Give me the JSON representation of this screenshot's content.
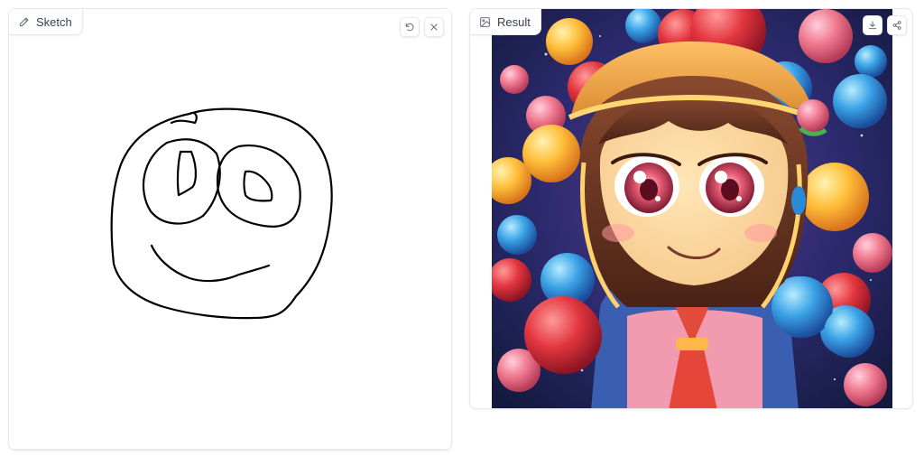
{
  "sketch": {
    "label": "Sketch",
    "label_icon": "pencil-icon",
    "actions": [
      "undo-icon",
      "close-icon"
    ]
  },
  "result": {
    "label": "Result",
    "label_icon": "image-icon",
    "actions": [
      "download-icon",
      "share-icon"
    ]
  },
  "colors": {
    "border": "#e5e7eb",
    "text": "#374151",
    "icon": "#6b7280"
  }
}
